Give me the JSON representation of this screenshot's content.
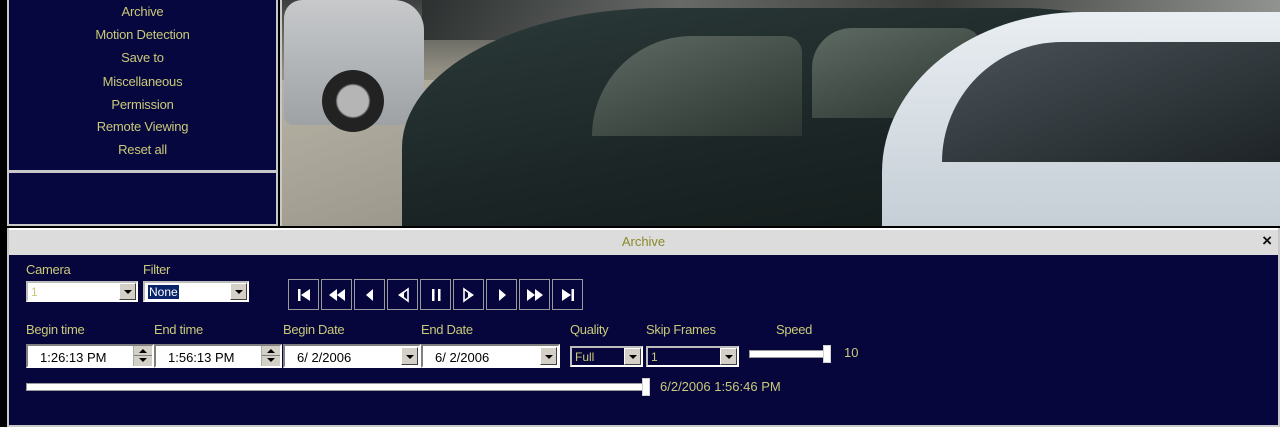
{
  "sidebar": {
    "items": [
      {
        "label": "Archive"
      },
      {
        "label": "Motion Detection"
      },
      {
        "label": "Save to"
      },
      {
        "label": "Miscellaneous"
      },
      {
        "label": "Permission"
      },
      {
        "label": "Remote Viewing"
      },
      {
        "label": "Reset all"
      }
    ]
  },
  "archive": {
    "title": "Archive",
    "close": "×",
    "camera": {
      "label": "Camera",
      "value": "1"
    },
    "filter": {
      "label": "Filter",
      "value": "None"
    },
    "begin_time": {
      "label": "Begin time",
      "value": "1:26:13 PM"
    },
    "end_time": {
      "label": "End time",
      "value": "1:56:13 PM"
    },
    "begin_date": {
      "label": "Begin Date",
      "value": "6/ 2/2006"
    },
    "end_date": {
      "label": "End Date",
      "value": "6/ 2/2006"
    },
    "quality": {
      "label": "Quality",
      "value": "Full"
    },
    "skip_frames": {
      "label": "Skip Frames",
      "value": "1"
    },
    "speed": {
      "label": "Speed",
      "value": "10",
      "level": 1.0
    },
    "position": {
      "value": "6/2/2006 1:56:46 PM",
      "level": 1.0
    },
    "transport_icons": [
      "skip-to-start-icon",
      "fast-rewind-icon",
      "step-back-icon",
      "slow-reverse-icon",
      "pause-icon",
      "slow-forward-icon",
      "play-icon",
      "fast-forward-icon",
      "skip-to-end-icon"
    ]
  },
  "colors": {
    "panel_bg": "#06063c",
    "label_text": "#c9c97a",
    "border": "#c8c8c8"
  }
}
